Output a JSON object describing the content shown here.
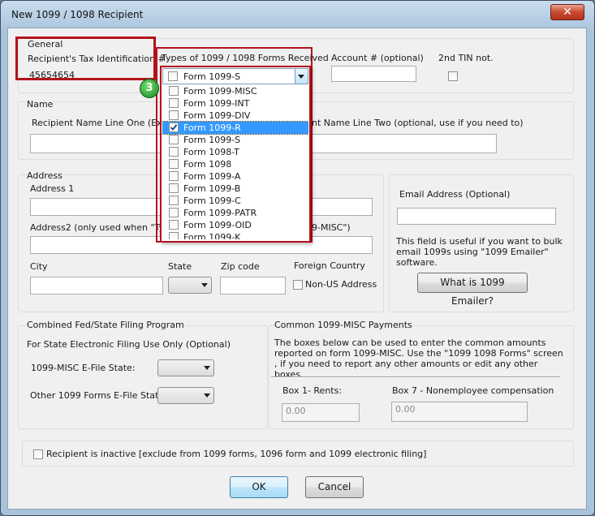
{
  "window": {
    "title": "New 1099 / 1098 Recipient",
    "close_glyph": "✕"
  },
  "general": {
    "group_label": "General",
    "tin_label": "Recipient's Tax Identification #",
    "tin_value": "45654654",
    "types_label": "Types of 1099 / 1098 Forms Received",
    "types_selected": "Form 1099-S",
    "account_label": "Account # (optional)",
    "account_value": "",
    "second_tin_label": "2nd TIN not."
  },
  "dropdown_items": [
    {
      "label": "Form 1099-MISC",
      "checked": false,
      "highlighted": false
    },
    {
      "label": "Form 1099-INT",
      "checked": false,
      "highlighted": false
    },
    {
      "label": "Form 1099-DIV",
      "checked": false,
      "highlighted": false
    },
    {
      "label": "Form 1099-R",
      "checked": true,
      "highlighted": true
    },
    {
      "label": "Form 1099-S",
      "checked": false,
      "highlighted": false
    },
    {
      "label": "Form 1098-T",
      "checked": false,
      "highlighted": false
    },
    {
      "label": "Form 1098",
      "checked": false,
      "highlighted": false
    },
    {
      "label": "Form 1099-A",
      "checked": false,
      "highlighted": false
    },
    {
      "label": "Form 1099-B",
      "checked": false,
      "highlighted": false
    },
    {
      "label": "Form 1099-C",
      "checked": false,
      "highlighted": false
    },
    {
      "label": "Form 1099-PATR",
      "checked": false,
      "highlighted": false
    },
    {
      "label": "Form 1099-OID",
      "checked": false,
      "highlighted": false
    },
    {
      "label": "Form 1099-K",
      "checked": false,
      "highlighted": false
    }
  ],
  "step_badge": "3",
  "name": {
    "group_label": "Name",
    "line1_label": "Recipient Name Line One (Exam",
    "line2_label": "nt Name Line Two (optional, use if you need to)"
  },
  "address": {
    "group_label": "Address",
    "address1_label": "Address 1",
    "address2_label": "Address2 (only used when \"Type",
    "address2_label_tail": "9-MISC\")",
    "city_label": "City",
    "state_label": "State",
    "zip_label": "Zip code",
    "foreign_label": "Foreign Country",
    "non_us_label": "Non-US Address"
  },
  "email": {
    "label": "Email Address (Optional)",
    "note": "This field is useful if you want to bulk email 1099s using \"1099 Emailer\" software.",
    "button": "What is 1099 Emailer?"
  },
  "fed_state": {
    "group_label": "Combined Fed/State Filing Program",
    "subtitle": "For State Electronic Filing Use Only (Optional)",
    "misc_label": "1099-MISC E-File State:",
    "other_label": "Other 1099 Forms E-File State:"
  },
  "misc_payments": {
    "group_label": "Common 1099-MISC Payments",
    "description": "The boxes below can be used to enter the common amounts reported on form 1099-MISC. Use the \"1099  1098 Forms\" screen , if you need to report any other amounts or edit any other boxes.",
    "box1_label": "Box 1- Rents:",
    "box1_value": "0.00",
    "box7_label": "Box 7 - Nonemployee compensation",
    "box7_value": "0.00"
  },
  "inactive_label": "Recipient is inactive [exclude from 1099 forms, 1096 form and 1099 electronic filing]",
  "buttons": {
    "ok": "OK",
    "cancel": "Cancel"
  },
  "colors": {
    "highlight": "#b5121b",
    "selection": "#3399ff",
    "badge": "#1c8a22"
  }
}
